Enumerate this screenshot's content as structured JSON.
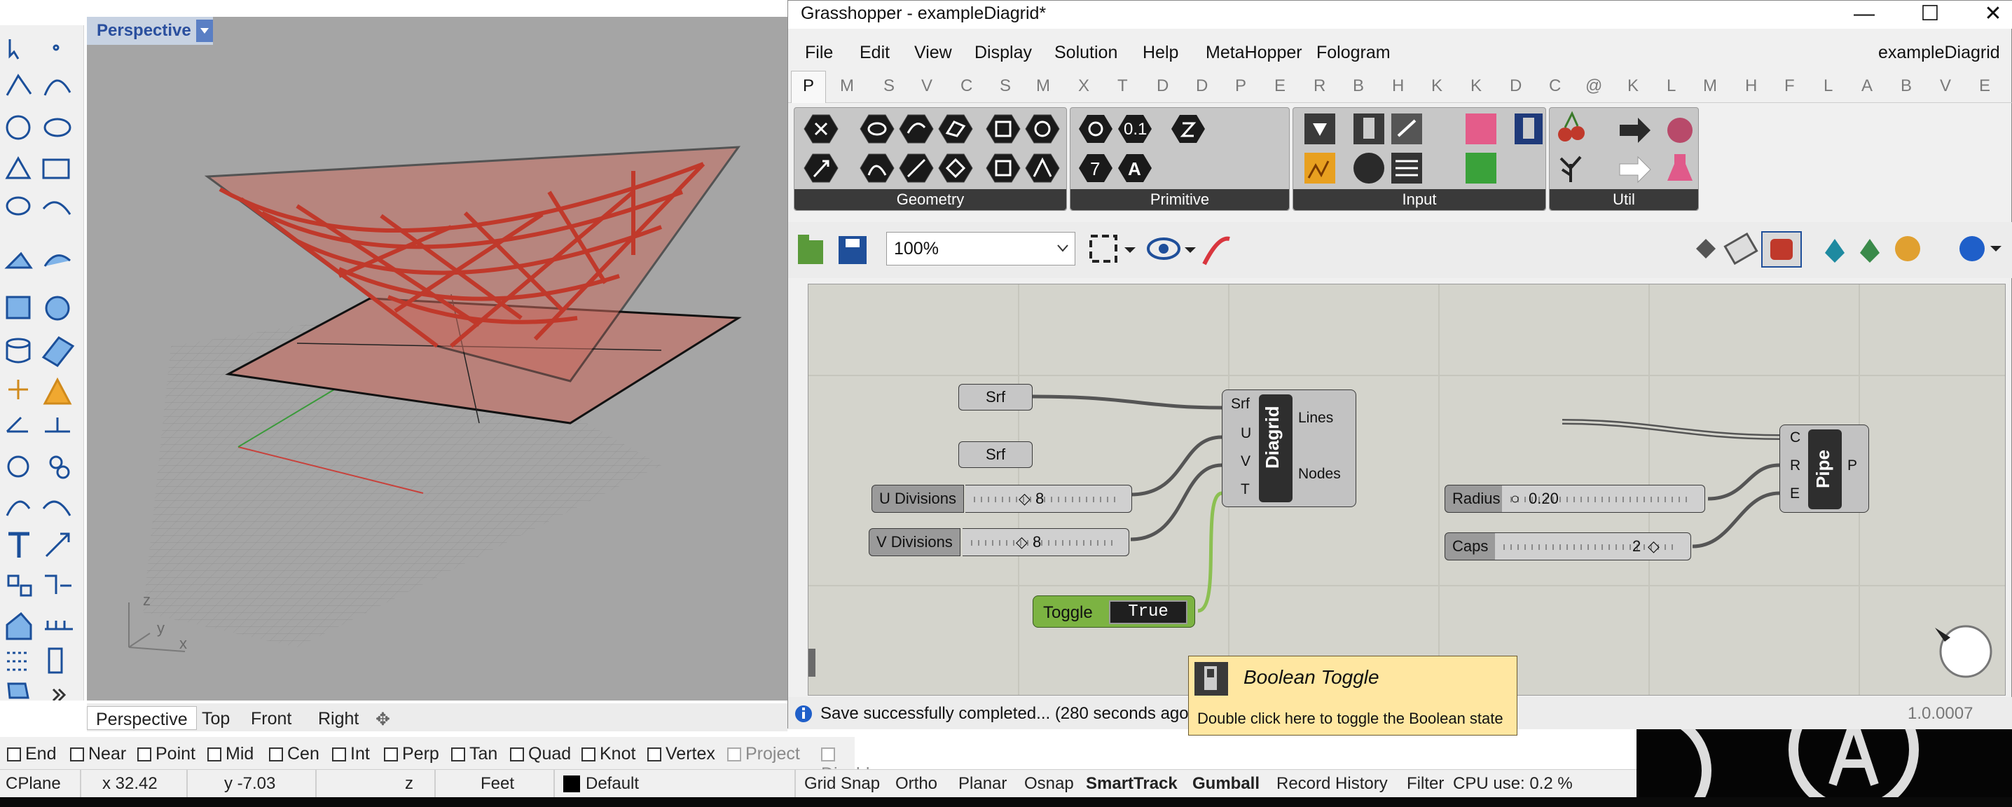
{
  "rhino": {
    "viewport_title": "Perspective",
    "view_tabs": [
      "Perspective",
      "Top",
      "Front",
      "Right"
    ],
    "axis_labels": {
      "z": "z",
      "y": "y",
      "x": "x"
    },
    "osnaps": [
      {
        "label": "End",
        "checked": false
      },
      {
        "label": "Near",
        "checked": false
      },
      {
        "label": "Point",
        "checked": false
      },
      {
        "label": "Mid",
        "checked": false
      },
      {
        "label": "Cen",
        "checked": false
      },
      {
        "label": "Int",
        "checked": false
      },
      {
        "label": "Perp",
        "checked": false
      },
      {
        "label": "Tan",
        "checked": false
      },
      {
        "label": "Quad",
        "checked": false
      },
      {
        "label": "Knot",
        "checked": false
      },
      {
        "label": "Vertex",
        "checked": false
      },
      {
        "label": "Project",
        "checked": false,
        "disabled": true
      },
      {
        "label": "Disable",
        "checked": false,
        "disabled": true
      }
    ],
    "status": {
      "cplane": "CPlane",
      "x": "x 32.42",
      "y": "y -7.03",
      "z": "z",
      "units": "Feet",
      "layer": "Default",
      "toggles": [
        "Grid Snap",
        "Ortho",
        "Planar",
        "Osnap",
        "SmartTrack",
        "Gumball",
        "Record History",
        "Filter"
      ],
      "active_toggles": [
        "SmartTrack",
        "Gumball"
      ],
      "cpu": "CPU use: 0.2 %"
    }
  },
  "grasshopper": {
    "title": "Grasshopper - exampleDiagrid*",
    "doc_name": "exampleDiagrid",
    "menu": [
      "File",
      "Edit",
      "View",
      "Display",
      "Solution",
      "Help",
      "MetaHopper",
      "Fologram"
    ],
    "tabs": [
      "P",
      "M",
      "S",
      "V",
      "C",
      "S",
      "M",
      "X",
      "T",
      "D",
      "D",
      "P",
      "E",
      "R",
      "B",
      "H",
      "K",
      "K",
      "D",
      "C",
      "@",
      "K",
      "L",
      "M",
      "H",
      "F",
      "L",
      "A",
      "B",
      "V",
      "E"
    ],
    "ribbon_groups": [
      "Geometry",
      "Primitive",
      "Input",
      "Util"
    ],
    "primitive_labels": {
      "num": "0.1",
      "seven": "7",
      "text": "A"
    },
    "zoom": "100%",
    "canvas": {
      "srf1": "Srf",
      "srf2": "Srf",
      "u_divisions": {
        "label": "U Divisions",
        "value": "8"
      },
      "v_divisions": {
        "label": "V Divisions",
        "value": "8"
      },
      "toggle": {
        "label": "Toggle",
        "value": "True"
      },
      "diagrid": {
        "name": "Diagrid",
        "inputs": [
          "Srf",
          "U",
          "V",
          "T"
        ],
        "outputs": [
          "Lines",
          "Nodes"
        ]
      },
      "radius": {
        "label": "Radius",
        "value": "0.20"
      },
      "caps": {
        "label": "Caps",
        "value": "2"
      },
      "pipe": {
        "name": "Pipe",
        "inputs": [
          "C",
          "R",
          "E"
        ],
        "outputs": [
          "P"
        ]
      }
    },
    "status_message": "Save successfully completed... (280 seconds ago)",
    "version": "1.0.0007",
    "tooltip": {
      "title": "Boolean Toggle",
      "text": "Double click here to toggle the Boolean state"
    }
  },
  "colors": {
    "surface": "#c0392b",
    "viewport_bg": "#a5a5a5",
    "canvas_bg": "#d4d4cc",
    "toggle_green": "#7cb342",
    "tooltip_bg": "#ffe7a1"
  }
}
